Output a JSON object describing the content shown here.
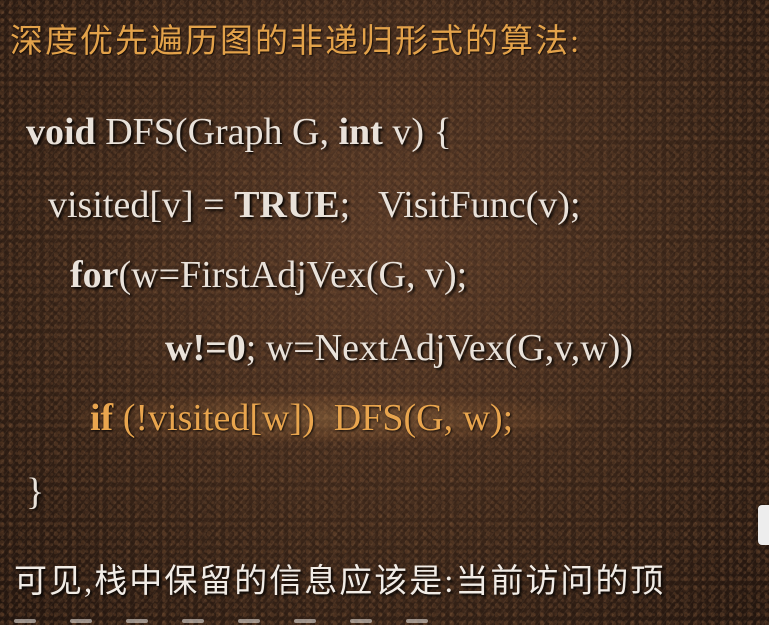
{
  "heading": "深度优先遍历图的非递归形式的算法:",
  "code": {
    "line1": {
      "kw": "void",
      "rest": " DFS(Graph G, ",
      "kw2": "int",
      "rest2": " v) {"
    },
    "line2": {
      "a": "visited[v] = ",
      "kw": "TRUE",
      "b": ";   VisitFunc(v);"
    },
    "line3": {
      "kw": "for",
      "rest": "(w=FirstAdjVex(G, v);"
    },
    "line4": {
      "kw": "w!=0",
      "rest": "; w=NextAdjVex(G,v,w))"
    },
    "line5": {
      "kw": "if",
      "rest": " (!visited[w])  DFS(G, w);"
    },
    "line6": "}"
  },
  "footer": "可见,栈中保留的信息应该是:当前访问的顶"
}
